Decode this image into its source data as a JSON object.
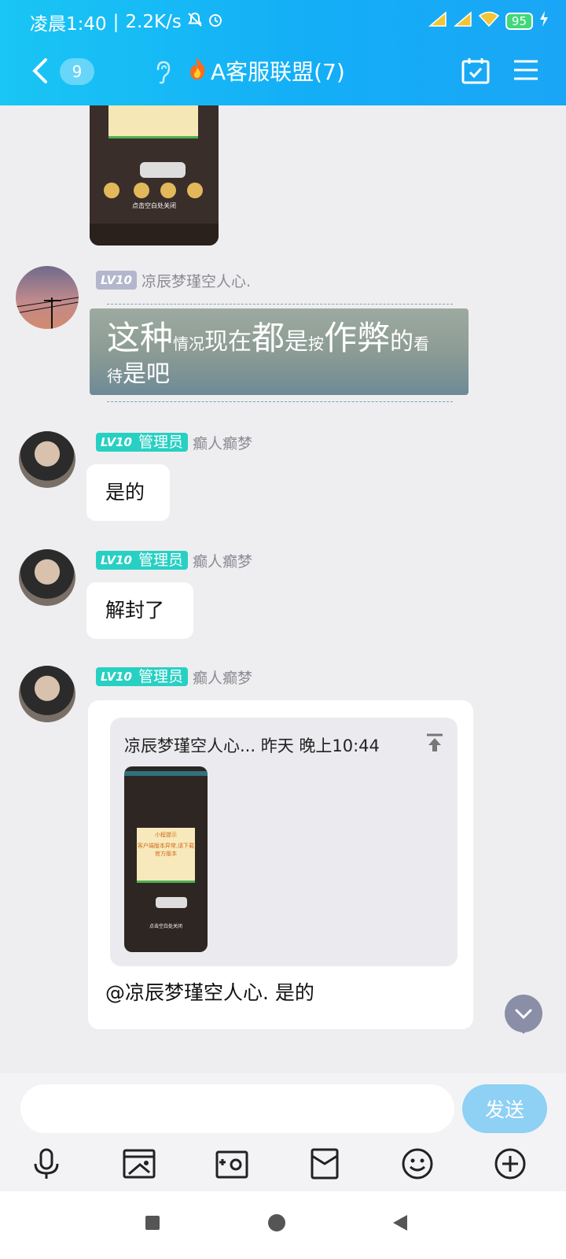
{
  "status_bar": {
    "time": "凌晨1:40",
    "network_speed": "2.2K/s",
    "battery": "95"
  },
  "header": {
    "back_badge": "9",
    "title": "A客服联盟(7)",
    "icons": [
      "back-icon",
      "ear-icon",
      "fire-icon",
      "calendar-check-icon",
      "menu-icon"
    ]
  },
  "messages": [
    {
      "sender": "凉辰梦瑾空人心.",
      "level": "LV10",
      "text_parts": [
        "这种",
        "情况",
        "现在",
        "都",
        "是",
        "按",
        "作弊",
        "的",
        "看",
        "待",
        "是吧"
      ]
    },
    {
      "sender": "癫人癫梦",
      "level": "LV10",
      "role": "管理员",
      "text": "是的"
    },
    {
      "sender": "癫人癫梦",
      "level": "LV10",
      "role": "管理员",
      "text": "解封了"
    },
    {
      "sender": "癫人癫梦",
      "level": "LV10",
      "role": "管理员",
      "quote": {
        "header": "凉辰梦瑾空人心... 昨天 晚上10:44",
        "image_note_title": "小程提示",
        "image_note_body": "客户端版本异常,请下载官方版本",
        "image_close": "点击空白处关闭"
      },
      "text": "@凉辰梦瑾空人心. 是的"
    }
  ],
  "top_image": {
    "close_text": "点击空白处关闭"
  },
  "input": {
    "placeholder": "",
    "send_label": "发送",
    "tools": [
      "microphone-icon",
      "image-icon",
      "camera-icon",
      "red-packet-icon",
      "emoji-icon",
      "plus-icon"
    ]
  },
  "colors": {
    "header_gradient_start": "#19c6f4",
    "header_gradient_end": "#1aa6f6",
    "admin_badge": "#28d0c3",
    "level_badge_gray": "#b3b6cc",
    "send_button": "#8fd0f5"
  }
}
